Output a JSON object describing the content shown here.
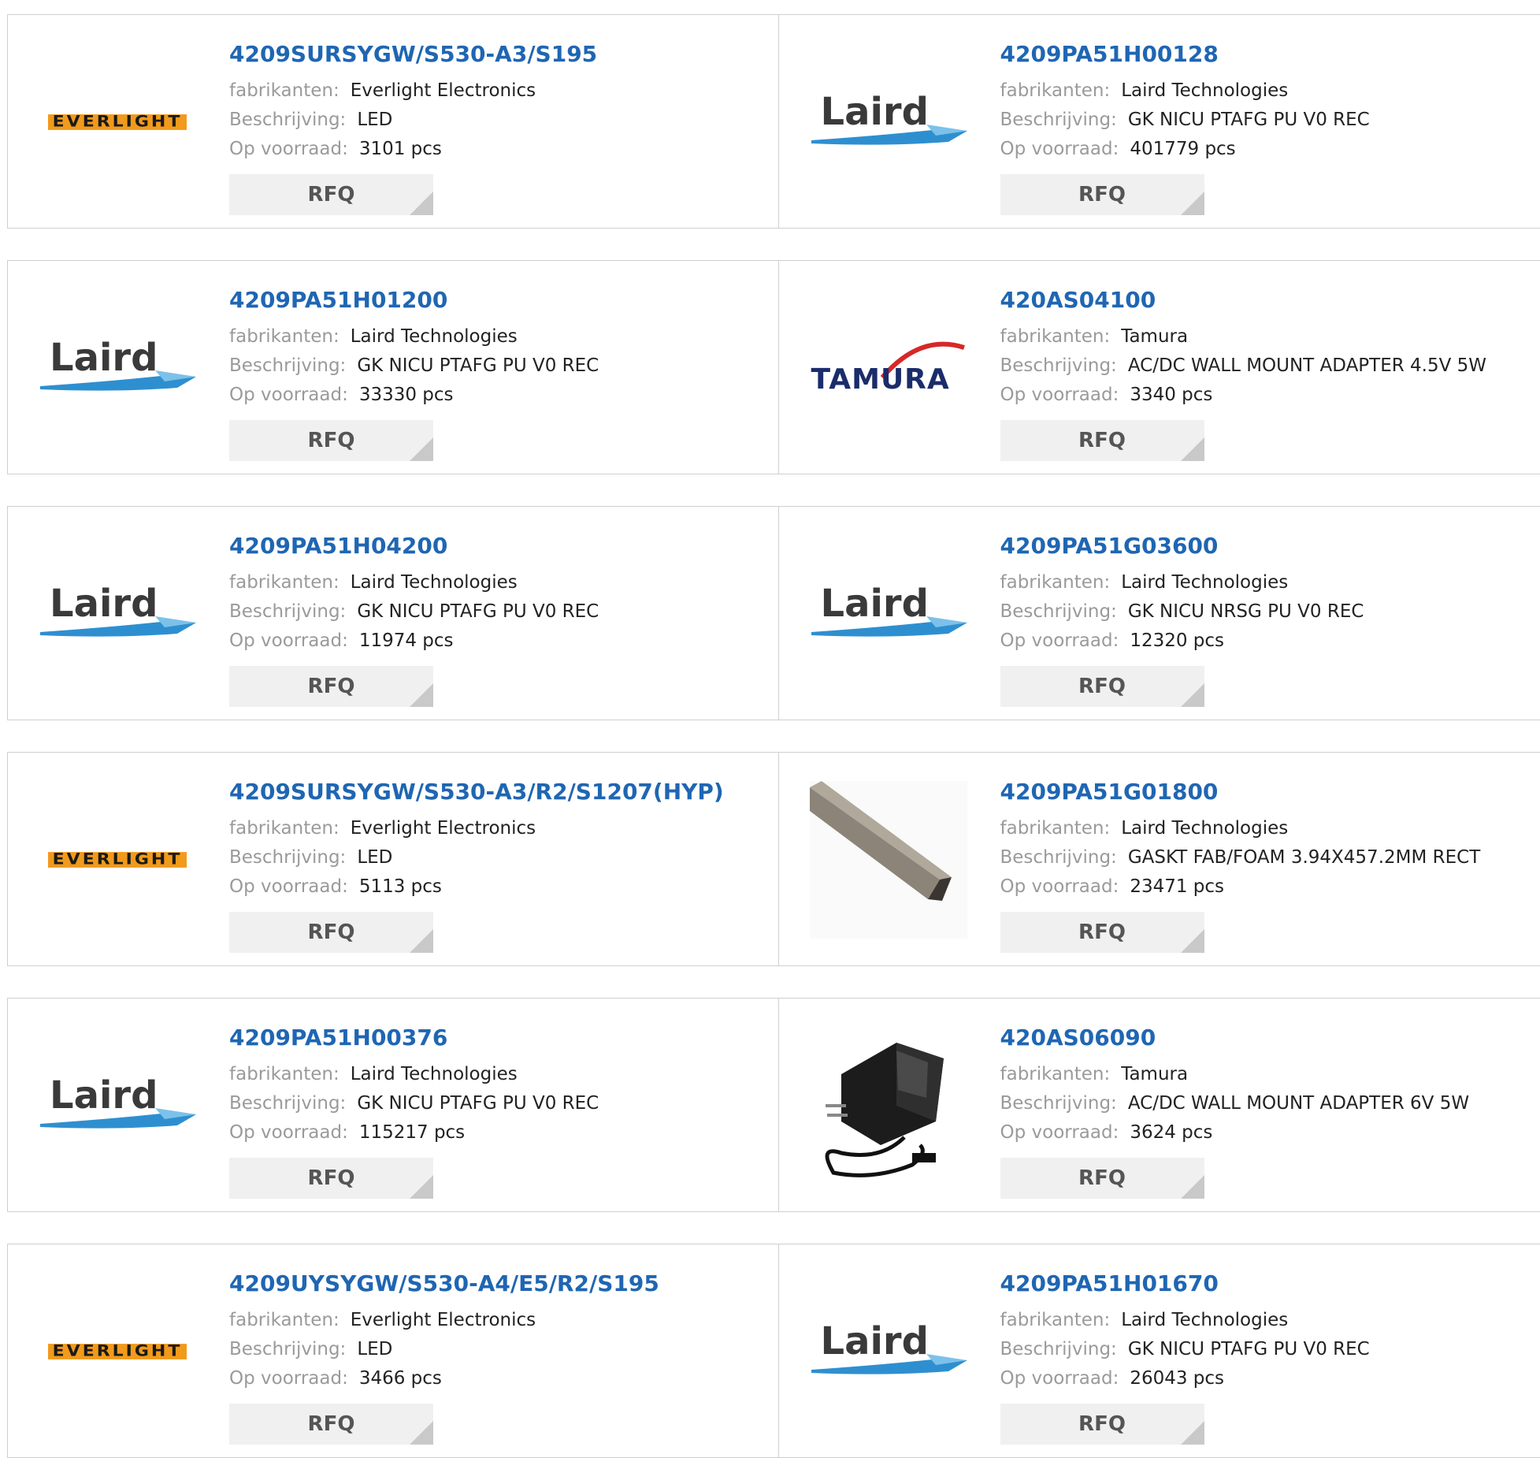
{
  "labels": {
    "manufacturer": "fabrikanten:",
    "description": "Beschrijving:",
    "stock": "Op voorraad:",
    "rfq": "RFQ"
  },
  "logos": {
    "everlight": "EVERLIGHT",
    "laird": "Laird",
    "tamura": "TAMURA"
  },
  "rows": [
    {
      "left": {
        "part": "4209SURSYGW/S530-A3/S195",
        "manufacturer": "Everlight Electronics",
        "description": "LED",
        "stock": "3101 pcs",
        "logo": "everlight"
      },
      "right": {
        "part": "4209PA51H00128",
        "manufacturer": "Laird Technologies",
        "description": "GK NICU PTAFG PU V0 REC",
        "stock": "401779 pcs",
        "logo": "laird"
      }
    },
    {
      "left": {
        "part": "4209PA51H01200",
        "manufacturer": "Laird Technologies",
        "description": "GK NICU PTAFG PU V0 REC",
        "stock": "33330 pcs",
        "logo": "laird"
      },
      "right": {
        "part": "420AS04100",
        "manufacturer": "Tamura",
        "description": "AC/DC WALL MOUNT ADAPTER 4.5V 5W",
        "stock": "3340 pcs",
        "logo": "tamura"
      }
    },
    {
      "left": {
        "part": "4209PA51H04200",
        "manufacturer": "Laird Technologies",
        "description": "GK NICU PTAFG PU V0 REC",
        "stock": "11974 pcs",
        "logo": "laird"
      },
      "right": {
        "part": "4209PA51G03600",
        "manufacturer": "Laird Technologies",
        "description": "GK NICU NRSG PU V0 REC",
        "stock": "12320 pcs",
        "logo": "laird"
      }
    },
    {
      "left": {
        "part": "4209SURSYGW/S530-A3/R2/S1207(HYP)",
        "manufacturer": "Everlight Electronics",
        "description": "LED",
        "stock": "5113 pcs",
        "logo": "everlight"
      },
      "right": {
        "part": "4209PA51G01800",
        "manufacturer": "Laird Technologies",
        "description": "GASKT FAB/FOAM 3.94X457.2MM RECT",
        "stock": "23471 pcs",
        "logo": "gasket-photo"
      }
    },
    {
      "left": {
        "part": "4209PA51H00376",
        "manufacturer": "Laird Technologies",
        "description": "GK NICU PTAFG PU V0 REC",
        "stock": "115217 pcs",
        "logo": "laird"
      },
      "right": {
        "part": "420AS06090",
        "manufacturer": "Tamura",
        "description": "AC/DC WALL MOUNT ADAPTER 6V 5W",
        "stock": "3624 pcs",
        "logo": "adapter-photo"
      }
    },
    {
      "left": {
        "part": "4209UYSYGW/S530-A4/E5/R2/S195",
        "manufacturer": "Everlight Electronics",
        "description": "LED",
        "stock": "3466 pcs",
        "logo": "everlight"
      },
      "right": {
        "part": "4209PA51H01670",
        "manufacturer": "Laird Technologies",
        "description": "GK NICU PTAFG PU V0 REC",
        "stock": "26043 pcs",
        "logo": "laird"
      }
    }
  ]
}
